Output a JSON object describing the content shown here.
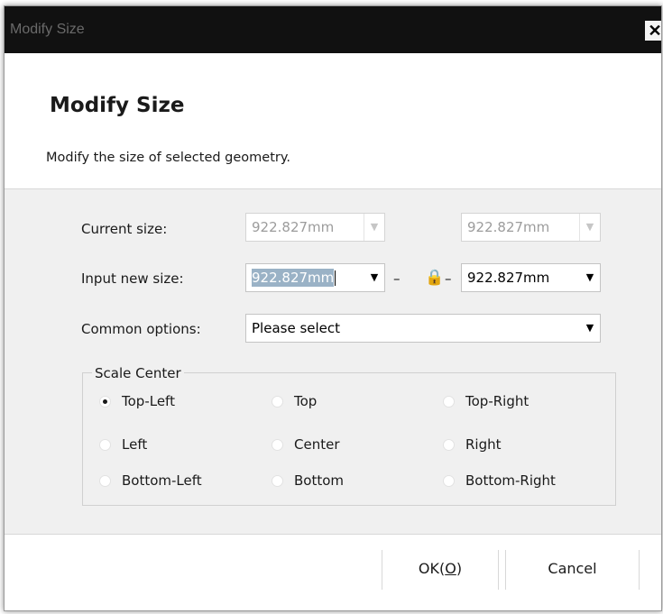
{
  "window": {
    "titlebar_text": "Modify Size",
    "close_glyph": "✕"
  },
  "header": {
    "title": "Modify Size",
    "description": "Modify the size of selected geometry."
  },
  "form": {
    "current_size_label": "Current size:",
    "current_width": "922.827mm",
    "current_height": "922.827mm",
    "input_new_size_label": "Input new size:",
    "new_width": "922.827mm",
    "new_height": "922.827mm",
    "link_dash": "–",
    "lock_icon_glyph": "🔒",
    "common_options_label": "Common options:",
    "common_options_value": "Please select"
  },
  "scale_center": {
    "title": "Scale Center",
    "options": [
      "Top-Left",
      "Top",
      "Top-Right",
      "Left",
      "Center",
      "Right",
      "Bottom-Left",
      "Bottom",
      "Bottom-Right"
    ],
    "selected": "Top-Left"
  },
  "buttons": {
    "ok_prefix": "OK(",
    "ok_mnemonic": "O",
    "ok_suffix": ")",
    "cancel": "Cancel"
  },
  "colors": {
    "titlebar": "#111111",
    "body": "#f0f0f0",
    "selection": "#9ab2c6"
  }
}
